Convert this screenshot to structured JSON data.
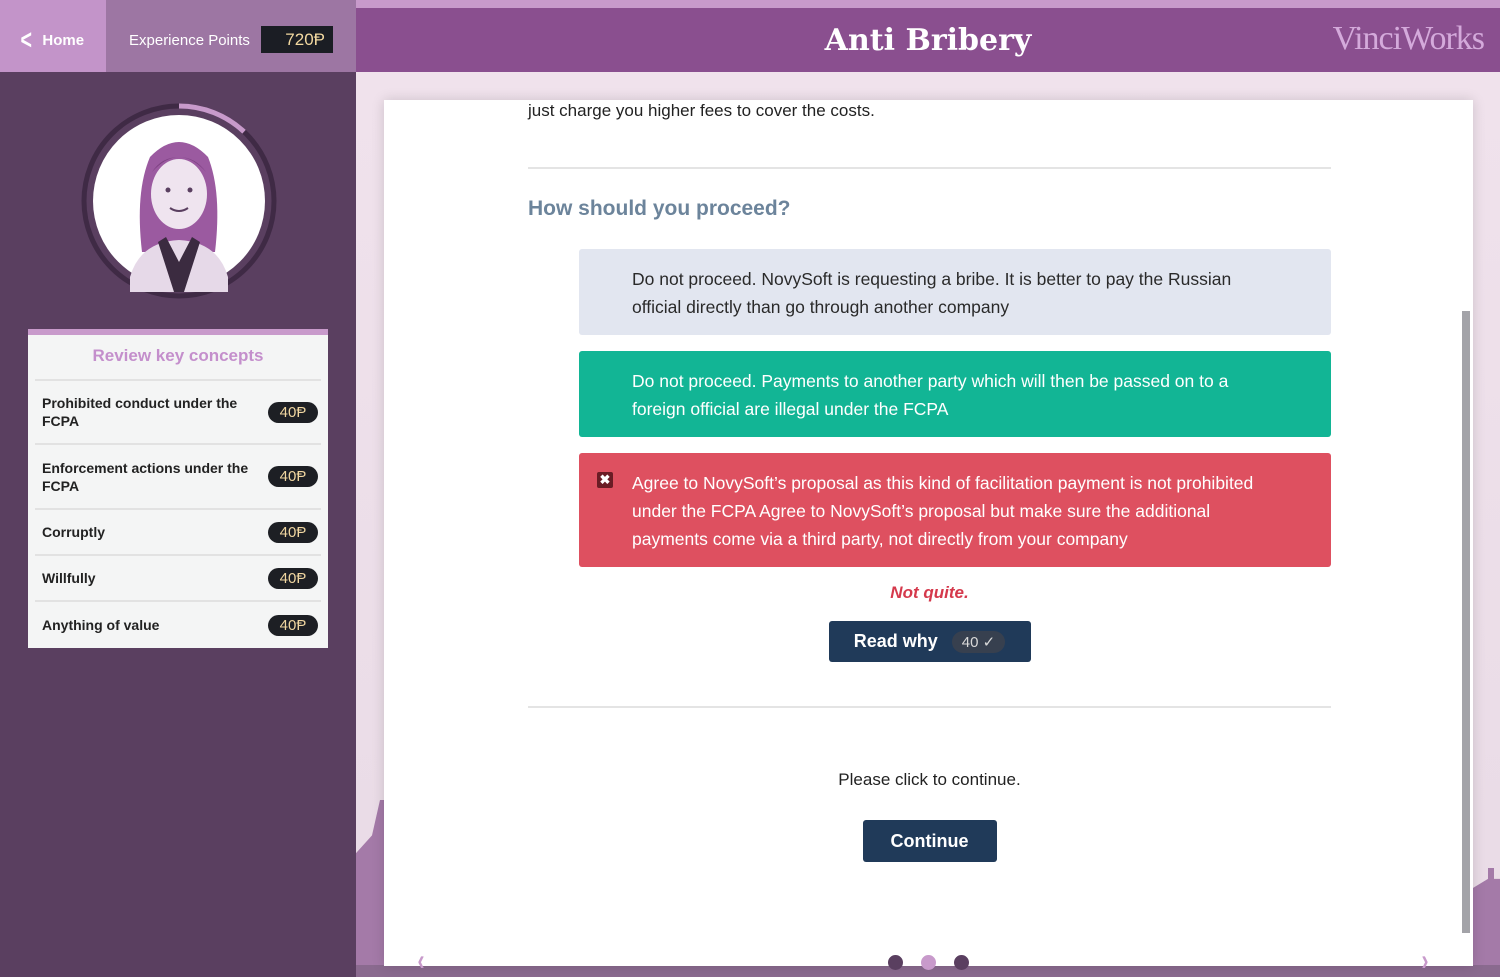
{
  "header": {
    "home_label": "Home",
    "xp_label": "Experience Points",
    "xp_value": "720Ᵽ",
    "title": "Anti Bribery",
    "brand": "VinciWorks"
  },
  "sidebar": {
    "avatar_progress": 0.12,
    "concepts_title": "Review key concepts",
    "concepts": [
      {
        "label": "Prohibited conduct under the FCPA",
        "points": "40Ᵽ"
      },
      {
        "label": "Enforcement actions under the FCPA",
        "points": "40Ᵽ"
      },
      {
        "label": "Corruptly",
        "points": "40Ᵽ"
      },
      {
        "label": "Willfully",
        "points": "40Ᵽ"
      },
      {
        "label": "Anything of value",
        "points": "40Ᵽ"
      }
    ]
  },
  "main": {
    "intro_text": "just charge you higher fees to cover the costs.",
    "question": "How should you proceed?",
    "options": [
      {
        "text": "Do not proceed. NovySoft is requesting a bribe. It is better to pay the Russian official directly than go through another company",
        "state": "neutral"
      },
      {
        "text": "Do not proceed. Payments to another party which will then be passed on to a foreign official are illegal under the FCPA",
        "state": "correct"
      },
      {
        "text": "Agree to NovySoft’s proposal as this kind of facilitation payment is not prohibited under the FCPA Agree to NovySoft’s proposal but make sure the additional payments come via a third party, not directly from your company",
        "state": "wrong",
        "icon": "x-icon"
      }
    ],
    "feedback": "Not quite.",
    "read_why_label": "Read why",
    "read_why_points": "40 ✓",
    "continue_prompt": "Please click to continue.",
    "continue_label": "Continue"
  },
  "pagination": {
    "prev_icon": "‹",
    "next_icon": "›",
    "total_pages": 3,
    "current_page": 2
  },
  "colors": {
    "accent": "#8a4f8f",
    "correct": "#12b595",
    "wrong": "#de5060",
    "button": "#203a59"
  }
}
